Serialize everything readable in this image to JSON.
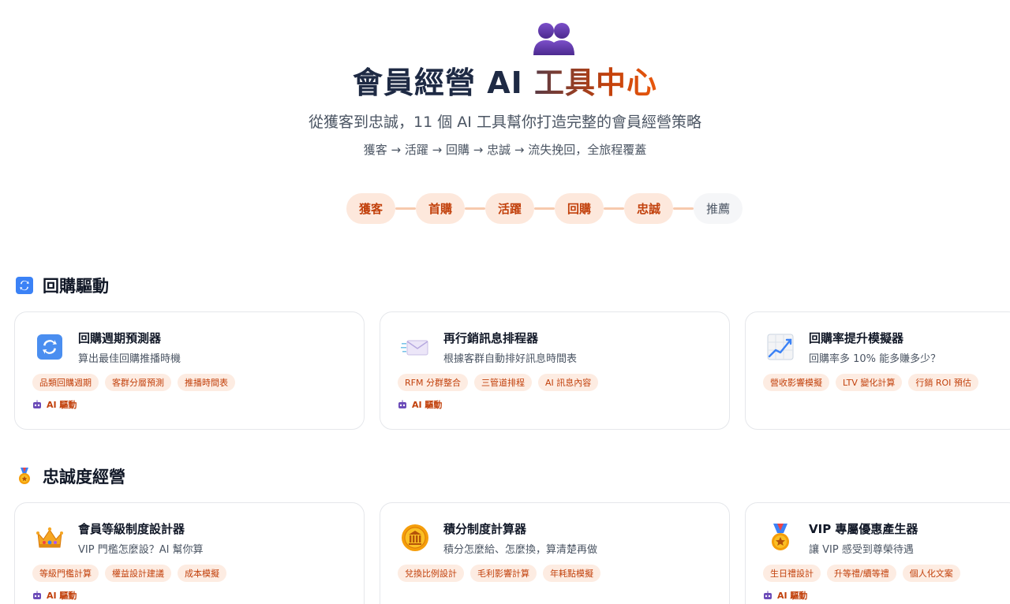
{
  "hero": {
    "icon": "busts-in-silhouette-icon",
    "title_main": "會員經營 AI ",
    "title_accent": "工具中心",
    "subtitle": "從獲客到忠誠，11 個 AI 工具幫你打造完整的會員經營策略",
    "flow": "獲客 → 活躍 → 回購 → 忠誠 → 流失挽回，全旅程覆蓋"
  },
  "journey": {
    "steps": [
      "獲客",
      "首購",
      "活躍",
      "回購",
      "忠誠",
      "推薦"
    ]
  },
  "sections": [
    {
      "icon": "repeat-arrows-icon",
      "title": "回購驅動",
      "cards": [
        {
          "icon": "repeat-arrows-icon",
          "title": "回購週期預測器",
          "desc": "算出最佳回購推播時機",
          "tags": [
            "品類回購週期",
            "客群分層預測",
            "推播時間表"
          ],
          "ai_label": "AI 驅動"
        },
        {
          "icon": "envelope-icon",
          "title": "再行銷訊息排程器",
          "desc": "根據客群自動排好訊息時間表",
          "tags": [
            "RFM 分群整合",
            "三管道排程",
            "AI 訊息內容"
          ],
          "ai_label": "AI 驅動"
        },
        {
          "icon": "chart-increasing-icon",
          "title": "回購率提升模擬器",
          "desc": "回購率多 10% 能多賺多少？",
          "tags": [
            "營收影響模擬",
            "LTV 變化計算",
            "行銷 ROI 預估"
          ],
          "ai_label": ""
        }
      ]
    },
    {
      "icon": "medal-icon",
      "title": "忠誠度經營",
      "cards": [
        {
          "icon": "crown-icon",
          "title": "會員等級制度設計器",
          "desc": "VIP 門檻怎麼設？AI 幫你算",
          "tags": [
            "等級門檻計算",
            "權益設計建議",
            "成本模擬"
          ],
          "ai_label": "AI 驅動"
        },
        {
          "icon": "coin-icon",
          "title": "積分制度計算器",
          "desc": "積分怎麼給、怎麼換，算清楚再做",
          "tags": [
            "兌換比例設計",
            "毛利影響計算",
            "年耗點模擬"
          ],
          "ai_label": ""
        },
        {
          "icon": "medal-icon",
          "title": "VIP 專屬優惠產生器",
          "desc": "讓 VIP 感受到尊榮待遇",
          "tags": [
            "生日禮設計",
            "升等禮/續等禮",
            "個人化文案"
          ],
          "ai_label": "AI 驅動"
        }
      ]
    }
  ],
  "colors": {
    "accent": "#c2410c",
    "tag_bg": "#fdece2",
    "step_bg": "#fde8dc",
    "connector": "#f7c9ad",
    "title": "#1e2a44"
  }
}
